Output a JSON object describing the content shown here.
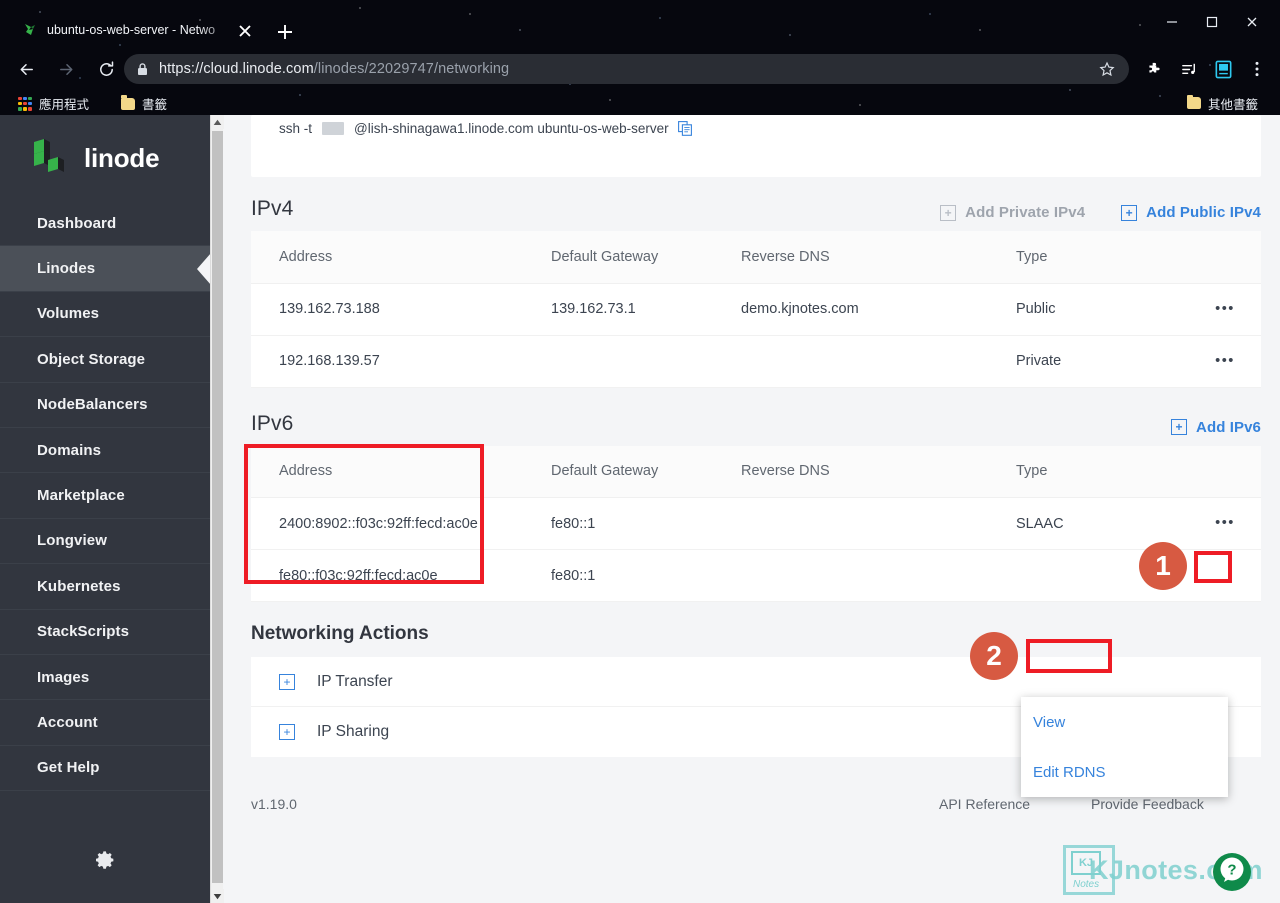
{
  "browser": {
    "tab": {
      "title": "ubuntu-os-web-server - Netwo",
      "favicon": "linode-leaf-icon"
    },
    "newtab_label": "+",
    "window_controls": [
      "minimize",
      "maximize",
      "close"
    ],
    "nav": {
      "back": "back-arrow",
      "forward": "forward-arrow",
      "reload": "reload"
    },
    "url": {
      "scheme": "https://",
      "host": "cloud.linode.com",
      "path": "/linodes/22029747/networking",
      "full": "https://cloud.linode.com/linodes/22029747/networking"
    },
    "toolbar_icons": [
      "extensions-puzzle-icon",
      "media-list-icon",
      "bookmark-manager-icon",
      "chrome-menu-icon"
    ],
    "bookmarks": {
      "apps_label": "應用程式",
      "bookmark_label": "書籤",
      "other_label": "其他書籤"
    }
  },
  "sidebar": {
    "brand": "linode",
    "items": [
      {
        "label": "Dashboard",
        "active": false
      },
      {
        "label": "Linodes",
        "active": true
      },
      {
        "label": "Volumes",
        "active": false
      },
      {
        "label": "Object Storage",
        "active": false
      },
      {
        "label": "NodeBalancers",
        "active": false
      },
      {
        "label": "Domains",
        "active": false
      },
      {
        "label": "Marketplace",
        "active": false
      },
      {
        "label": "Longview",
        "active": false
      },
      {
        "label": "Kubernetes",
        "active": false
      },
      {
        "label": "StackScripts",
        "active": false
      },
      {
        "label": "Images",
        "active": false
      },
      {
        "label": "Account",
        "active": false
      },
      {
        "label": "Get Help",
        "active": false
      }
    ],
    "settings_icon": "gear-icon"
  },
  "ssh": {
    "prefix": "ssh -t",
    "suffix": "@lish-shinagawa1.linode.com ubuntu-os-web-server",
    "copy_icon": "copy-icon"
  },
  "ipv4": {
    "title": "IPv4",
    "add_private_label": "Add Private IPv4",
    "add_public_label": "Add Public IPv4",
    "columns": [
      "Address",
      "Default Gateway",
      "Reverse DNS",
      "Type"
    ],
    "rows": [
      {
        "address": "139.162.73.188",
        "gateway": "139.162.73.1",
        "rdns": "demo.kjnotes.com",
        "type": "Public"
      },
      {
        "address": "192.168.139.57",
        "gateway": "",
        "rdns": "",
        "type": "Private"
      }
    ]
  },
  "ipv6": {
    "title": "IPv6",
    "add_label": "Add IPv6",
    "columns": [
      "Address",
      "Default Gateway",
      "Reverse DNS",
      "Type"
    ],
    "rows": [
      {
        "address": "2400:8902::f03c:92ff:fecd:ac0e",
        "gateway": "fe80::1",
        "rdns": "",
        "type": "SLAAC"
      },
      {
        "address": "fe80::f03c:92ff:fecd:ac0e",
        "gateway": "fe80::1",
        "rdns": "",
        "type": ""
      }
    ]
  },
  "menu": {
    "items": [
      {
        "label": "View"
      },
      {
        "label": "Edit RDNS"
      }
    ]
  },
  "actions": {
    "title": "Networking Actions",
    "items": [
      {
        "label": "IP Transfer"
      },
      {
        "label": "IP Sharing"
      }
    ]
  },
  "footer": {
    "version": "v1.19.0",
    "api_reference": "API Reference",
    "provide_feedback": "Provide Feedback",
    "help_icon": "question-mark-icon"
  },
  "watermark": {
    "text": "KJnotes.com",
    "mark": "KJ",
    "sub": "Notes"
  },
  "annotations": {
    "badges": [
      {
        "number": "1"
      },
      {
        "number": "2"
      }
    ],
    "highlight_color": "#ee1c25",
    "badge_color": "#d75a42"
  }
}
